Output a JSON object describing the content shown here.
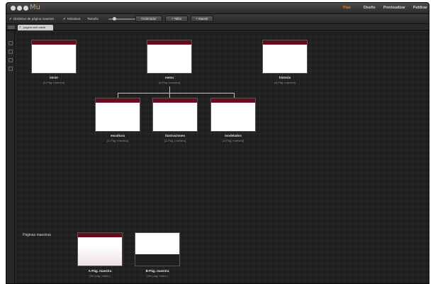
{
  "app": {
    "name": "Mu"
  },
  "modes": [
    {
      "label": "Plan",
      "active": true
    },
    {
      "label": "Diseño",
      "active": false
    },
    {
      "label": "Previsualizar",
      "active": false
    },
    {
      "label": "Publicar",
      "active": false
    }
  ],
  "toolbar": {
    "show_master_label": "Distintivo de página maestra",
    "thumbnails_label": "Miniatura",
    "size_label": "Tamaño",
    "sort_button": "Ordenador",
    "tree_button": "+ Tallar",
    "master_button": "+ Maestr"
  },
  "tab": {
    "label": "pagina web casla"
  },
  "pages": [
    {
      "id": "inicio",
      "title": "inicio",
      "sub": "[A-Pág. maestra]"
    },
    {
      "id": "menu",
      "title": "menu",
      "sub": "[A-Pág. maestra]"
    },
    {
      "id": "historia",
      "title": "historia",
      "sub": "[A-Pág. maestra]"
    },
    {
      "id": "escultura",
      "title": "escultura",
      "sub": "[A-Pág. maestra]"
    },
    {
      "id": "ilustraciones",
      "title": "ilustraciones",
      "sub": "[A-Pág. maestra]"
    },
    {
      "id": "modelados",
      "title": "modelados",
      "sub": "[A-Pág. maestra]"
    }
  ],
  "masters": {
    "section_label": "Páginas maestras",
    "items": [
      {
        "id": "a",
        "title": "A-Pág. maestra",
        "sub": "[Sin pág. maes.]"
      },
      {
        "id": "b",
        "title": "B-Pág. maestra",
        "sub": "[Sin pág. maes.]"
      }
    ]
  },
  "colors": {
    "accent": "#f07a1e",
    "band": "#6b0a1e",
    "canvas": "#1f1f1f"
  }
}
